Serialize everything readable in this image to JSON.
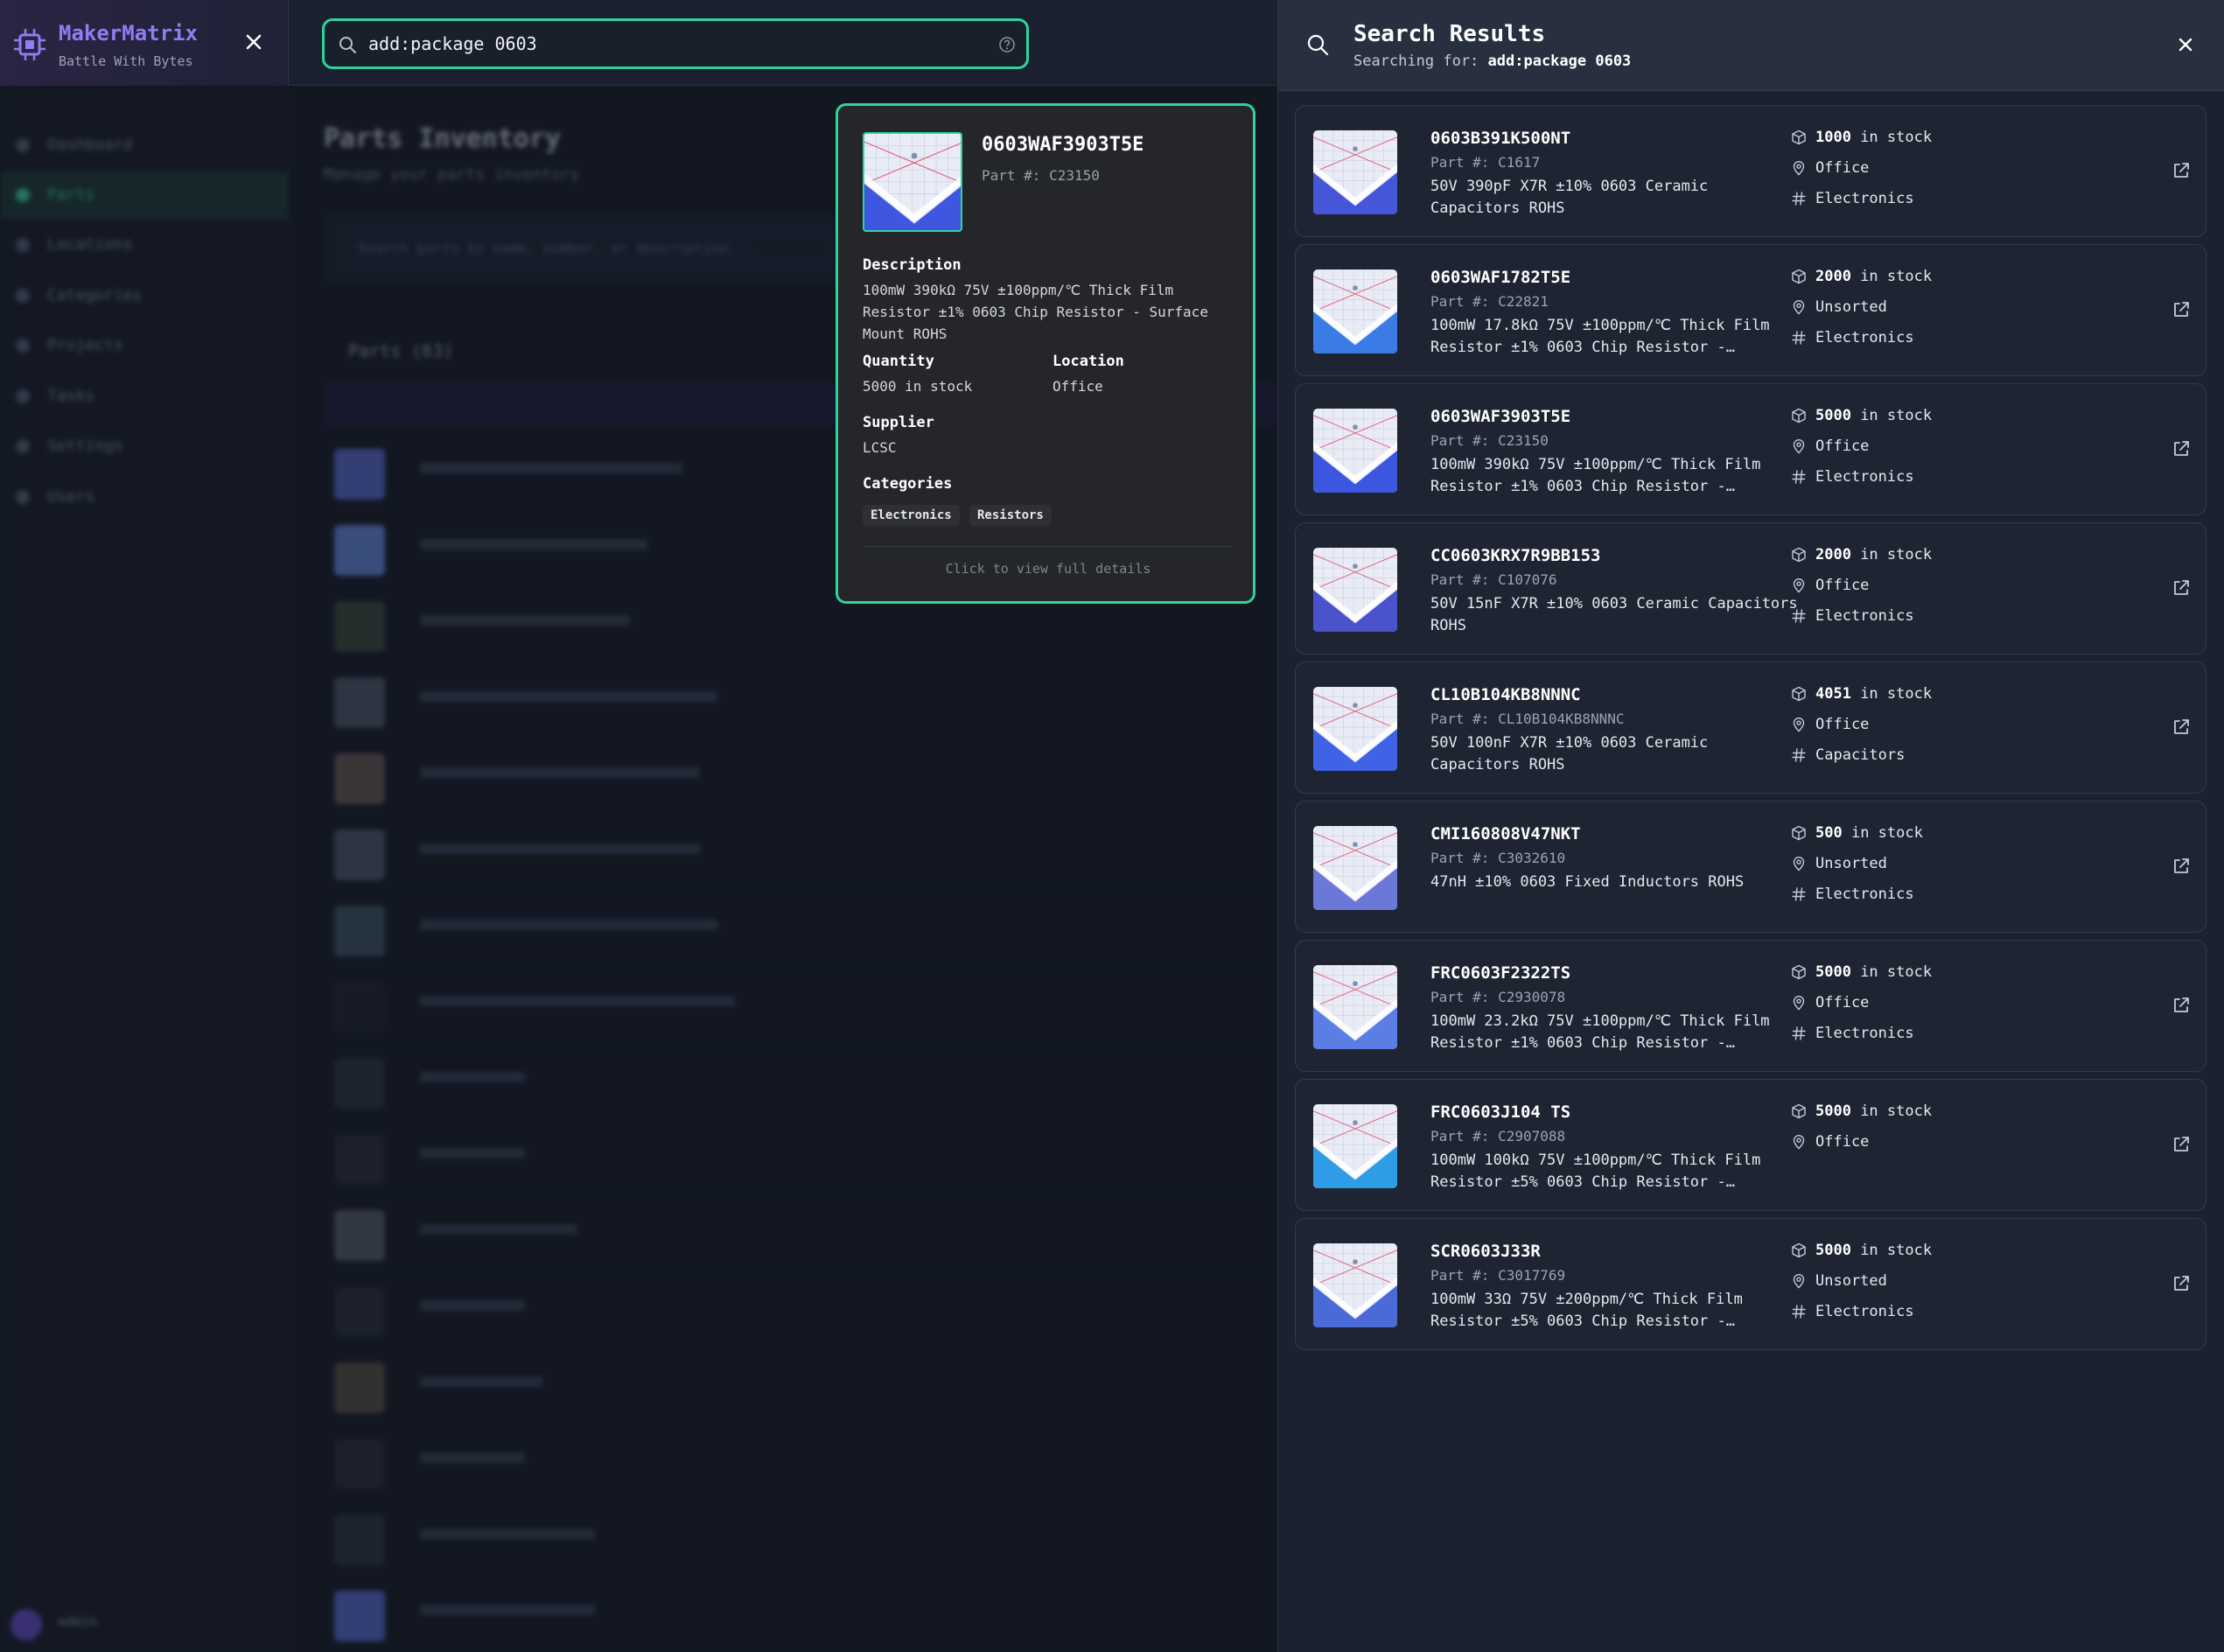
{
  "brand": {
    "title": "MakerMatrix",
    "subtitle": "Battle With Bytes"
  },
  "search": {
    "value": "add:package 0603"
  },
  "sidebar": {
    "items": [
      {
        "label": "Dashboard"
      },
      {
        "label": "Parts"
      },
      {
        "label": "Locations"
      },
      {
        "label": "Categories"
      },
      {
        "label": "Projects"
      },
      {
        "label": "Tasks"
      },
      {
        "label": "Settings"
      },
      {
        "label": "Users"
      }
    ],
    "active_index": 1,
    "user": "admin"
  },
  "main": {
    "title": "Parts Inventory",
    "subtitle": "Manage your parts inventory",
    "filter_placeholder": "Search parts by name, number, or description...",
    "table_label": "Parts (63)"
  },
  "hover_card": {
    "title": "0603WAF3903T5E",
    "part_number": "Part #: C23150",
    "description_label": "Description",
    "description": "100mW 390kΩ 75V ±100ppm/℃ Thick Film Resistor ±1% 0603 Chip Resistor - Surface Mount ROHS",
    "quantity_label": "Quantity",
    "quantity": "5000 in stock",
    "location_label": "Location",
    "location": "Office",
    "supplier_label": "Supplier",
    "supplier": "LCSC",
    "categories_label": "Categories",
    "categories": [
      "Electronics",
      "Resistors"
    ],
    "footer": "Click to view full details"
  },
  "results": {
    "title": "Search Results",
    "subtitle_prefix": "Searching for: ",
    "query": "add:package 0603",
    "stock_suffix": " in stock",
    "items": [
      {
        "name": "0603B391K500NT",
        "part": "Part #: C1617",
        "desc": "50V 390pF X7R ±10% 0603 Ceramic Capacitors ROHS",
        "qty": "1000",
        "location": "Office",
        "category": "Electronics"
      },
      {
        "name": "0603WAF1782T5E",
        "part": "Part #: C22821",
        "desc": "100mW 17.8kΩ 75V ±100ppm/℃ Thick Film Resistor ±1% 0603 Chip Resistor -…",
        "qty": "2000",
        "location": "Unsorted",
        "category": "Electronics"
      },
      {
        "name": "0603WAF3903T5E",
        "part": "Part #: C23150",
        "desc": "100mW 390kΩ 75V ±100ppm/℃ Thick Film Resistor ±1% 0603 Chip Resistor -…",
        "qty": "5000",
        "location": "Office",
        "category": "Electronics"
      },
      {
        "name": "CC0603KRX7R9BB153",
        "part": "Part #: C107076",
        "desc": "50V 15nF X7R ±10% 0603 Ceramic Capacitors ROHS",
        "qty": "2000",
        "location": "Office",
        "category": "Electronics"
      },
      {
        "name": "CL10B104KB8NNNC",
        "part": "Part #: CL10B104KB8NNNC",
        "desc": "50V 100nF X7R ±10% 0603 Ceramic Capacitors ROHS",
        "qty": "4051",
        "location": "Office",
        "category": "Capacitors"
      },
      {
        "name": "CMI160808V47NKT",
        "part": "Part #: C3032610",
        "desc": "47nH ±10% 0603 Fixed Inductors ROHS",
        "qty": "500",
        "location": "Unsorted",
        "category": "Electronics"
      },
      {
        "name": "FRC0603F2322TS",
        "part": "Part #: C2930078",
        "desc": "100mW 23.2kΩ 75V ±100ppm/℃ Thick Film Resistor ±1% 0603 Chip Resistor -…",
        "qty": "5000",
        "location": "Office",
        "category": "Electronics"
      },
      {
        "name": "FRC0603J104 TS",
        "part": "Part #: C2907088",
        "desc": "100mW 100kΩ 75V ±100ppm/℃ Thick Film Resistor ±5% 0603 Chip Resistor -…",
        "qty": "5000",
        "location": "Office",
        "category": ""
      },
      {
        "name": "SCR0603J33R",
        "part": "Part #: C3017769",
        "desc": "100mW 33Ω 75V ±200ppm/℃ Thick Film Resistor ±5% 0603 Chip Resistor -…",
        "qty": "5000",
        "location": "Unsorted",
        "category": "Electronics"
      }
    ]
  },
  "colors": {
    "accent": "#2ed49a",
    "brand": "#8f7df3",
    "panel": "#1b2130",
    "card": "#1e2432"
  }
}
